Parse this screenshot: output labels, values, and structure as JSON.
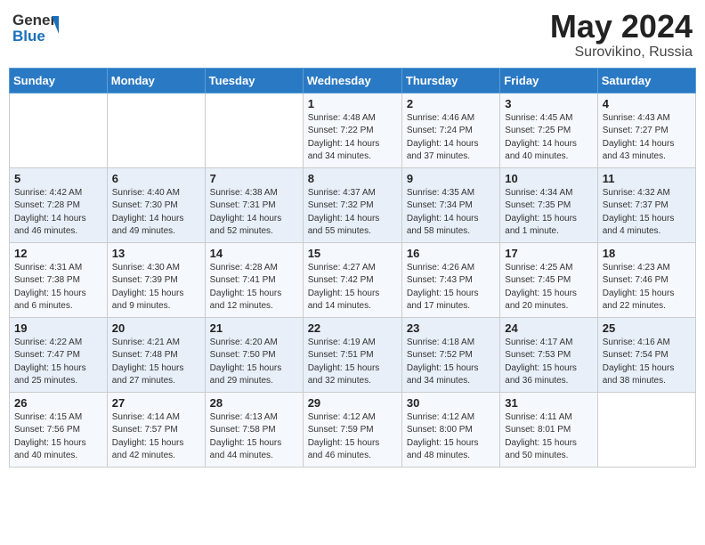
{
  "header": {
    "logo_general": "General",
    "logo_blue": "Blue",
    "title": "May 2024",
    "location": "Surovikino, Russia"
  },
  "days_of_week": [
    "Sunday",
    "Monday",
    "Tuesday",
    "Wednesday",
    "Thursday",
    "Friday",
    "Saturday"
  ],
  "weeks": [
    {
      "days": [
        {
          "num": "",
          "info": ""
        },
        {
          "num": "",
          "info": ""
        },
        {
          "num": "",
          "info": ""
        },
        {
          "num": "1",
          "info": "Sunrise: 4:48 AM\nSunset: 7:22 PM\nDaylight: 14 hours\nand 34 minutes."
        },
        {
          "num": "2",
          "info": "Sunrise: 4:46 AM\nSunset: 7:24 PM\nDaylight: 14 hours\nand 37 minutes."
        },
        {
          "num": "3",
          "info": "Sunrise: 4:45 AM\nSunset: 7:25 PM\nDaylight: 14 hours\nand 40 minutes."
        },
        {
          "num": "4",
          "info": "Sunrise: 4:43 AM\nSunset: 7:27 PM\nDaylight: 14 hours\nand 43 minutes."
        }
      ]
    },
    {
      "days": [
        {
          "num": "5",
          "info": "Sunrise: 4:42 AM\nSunset: 7:28 PM\nDaylight: 14 hours\nand 46 minutes."
        },
        {
          "num": "6",
          "info": "Sunrise: 4:40 AM\nSunset: 7:30 PM\nDaylight: 14 hours\nand 49 minutes."
        },
        {
          "num": "7",
          "info": "Sunrise: 4:38 AM\nSunset: 7:31 PM\nDaylight: 14 hours\nand 52 minutes."
        },
        {
          "num": "8",
          "info": "Sunrise: 4:37 AM\nSunset: 7:32 PM\nDaylight: 14 hours\nand 55 minutes."
        },
        {
          "num": "9",
          "info": "Sunrise: 4:35 AM\nSunset: 7:34 PM\nDaylight: 14 hours\nand 58 minutes."
        },
        {
          "num": "10",
          "info": "Sunrise: 4:34 AM\nSunset: 7:35 PM\nDaylight: 15 hours\nand 1 minute."
        },
        {
          "num": "11",
          "info": "Sunrise: 4:32 AM\nSunset: 7:37 PM\nDaylight: 15 hours\nand 4 minutes."
        }
      ]
    },
    {
      "days": [
        {
          "num": "12",
          "info": "Sunrise: 4:31 AM\nSunset: 7:38 PM\nDaylight: 15 hours\nand 6 minutes."
        },
        {
          "num": "13",
          "info": "Sunrise: 4:30 AM\nSunset: 7:39 PM\nDaylight: 15 hours\nand 9 minutes."
        },
        {
          "num": "14",
          "info": "Sunrise: 4:28 AM\nSunset: 7:41 PM\nDaylight: 15 hours\nand 12 minutes."
        },
        {
          "num": "15",
          "info": "Sunrise: 4:27 AM\nSunset: 7:42 PM\nDaylight: 15 hours\nand 14 minutes."
        },
        {
          "num": "16",
          "info": "Sunrise: 4:26 AM\nSunset: 7:43 PM\nDaylight: 15 hours\nand 17 minutes."
        },
        {
          "num": "17",
          "info": "Sunrise: 4:25 AM\nSunset: 7:45 PM\nDaylight: 15 hours\nand 20 minutes."
        },
        {
          "num": "18",
          "info": "Sunrise: 4:23 AM\nSunset: 7:46 PM\nDaylight: 15 hours\nand 22 minutes."
        }
      ]
    },
    {
      "days": [
        {
          "num": "19",
          "info": "Sunrise: 4:22 AM\nSunset: 7:47 PM\nDaylight: 15 hours\nand 25 minutes."
        },
        {
          "num": "20",
          "info": "Sunrise: 4:21 AM\nSunset: 7:48 PM\nDaylight: 15 hours\nand 27 minutes."
        },
        {
          "num": "21",
          "info": "Sunrise: 4:20 AM\nSunset: 7:50 PM\nDaylight: 15 hours\nand 29 minutes."
        },
        {
          "num": "22",
          "info": "Sunrise: 4:19 AM\nSunset: 7:51 PM\nDaylight: 15 hours\nand 32 minutes."
        },
        {
          "num": "23",
          "info": "Sunrise: 4:18 AM\nSunset: 7:52 PM\nDaylight: 15 hours\nand 34 minutes."
        },
        {
          "num": "24",
          "info": "Sunrise: 4:17 AM\nSunset: 7:53 PM\nDaylight: 15 hours\nand 36 minutes."
        },
        {
          "num": "25",
          "info": "Sunrise: 4:16 AM\nSunset: 7:54 PM\nDaylight: 15 hours\nand 38 minutes."
        }
      ]
    },
    {
      "days": [
        {
          "num": "26",
          "info": "Sunrise: 4:15 AM\nSunset: 7:56 PM\nDaylight: 15 hours\nand 40 minutes."
        },
        {
          "num": "27",
          "info": "Sunrise: 4:14 AM\nSunset: 7:57 PM\nDaylight: 15 hours\nand 42 minutes."
        },
        {
          "num": "28",
          "info": "Sunrise: 4:13 AM\nSunset: 7:58 PM\nDaylight: 15 hours\nand 44 minutes."
        },
        {
          "num": "29",
          "info": "Sunrise: 4:12 AM\nSunset: 7:59 PM\nDaylight: 15 hours\nand 46 minutes."
        },
        {
          "num": "30",
          "info": "Sunrise: 4:12 AM\nSunset: 8:00 PM\nDaylight: 15 hours\nand 48 minutes."
        },
        {
          "num": "31",
          "info": "Sunrise: 4:11 AM\nSunset: 8:01 PM\nDaylight: 15 hours\nand 50 minutes."
        },
        {
          "num": "",
          "info": ""
        }
      ]
    }
  ]
}
